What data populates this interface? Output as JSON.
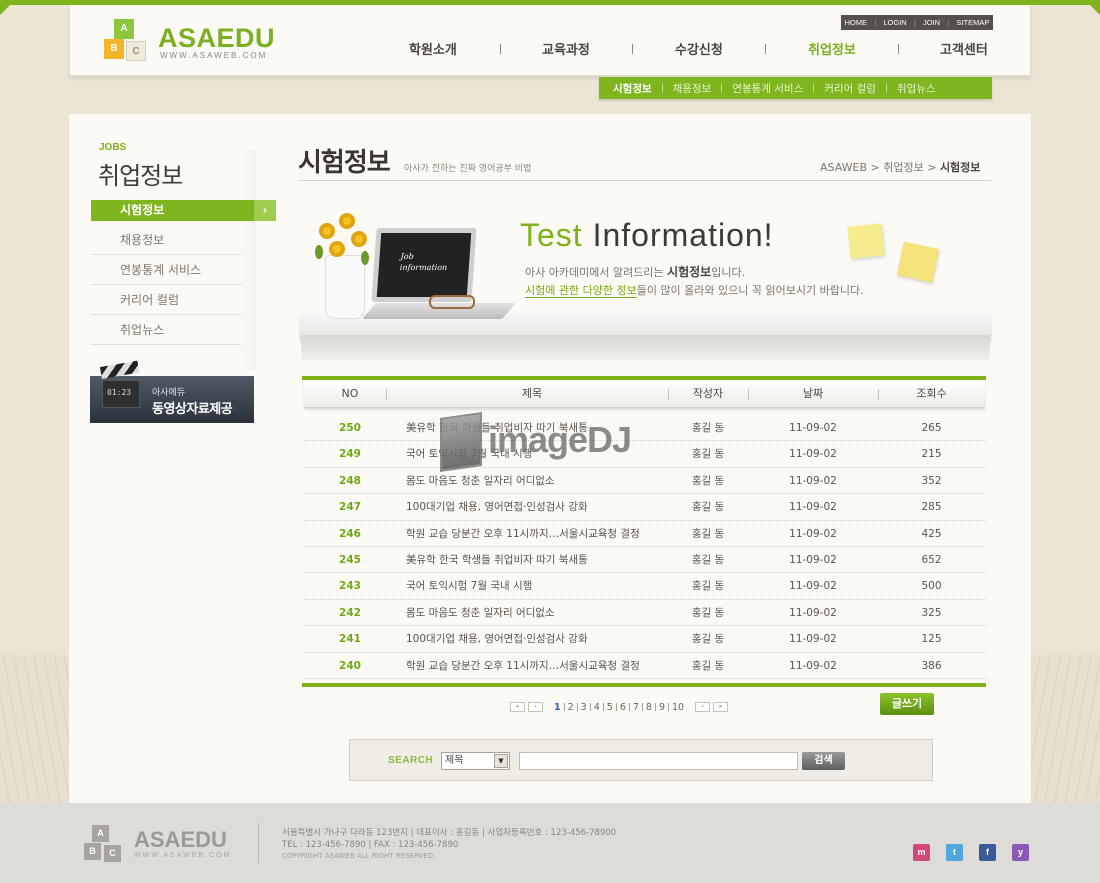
{
  "brand": {
    "name_green": "ASA",
    "name_gray": "EDU",
    "domain": "WWW.ASAWEB.COM",
    "blocks": [
      "A",
      "B",
      "C"
    ]
  },
  "util_links": [
    "HOME",
    "LOGIN",
    "JOIN",
    "SITEMAP"
  ],
  "gnb": [
    {
      "label": "학원소개",
      "active": false
    },
    {
      "label": "교육과정",
      "active": false
    },
    {
      "label": "수강신청",
      "active": false
    },
    {
      "label": "취업정보",
      "active": true
    },
    {
      "label": "고객센터",
      "active": false
    }
  ],
  "subnav": [
    {
      "label": "시험정보",
      "active": true
    },
    {
      "label": "채용정보",
      "active": false
    },
    {
      "label": "연봉통계 서비스",
      "active": false
    },
    {
      "label": "커리어 컬럼",
      "active": false
    },
    {
      "label": "취업뉴스",
      "active": false
    }
  ],
  "lnb": {
    "heading_en": "JOBS",
    "heading": "취업정보",
    "items": [
      {
        "label": "시험정보",
        "active": true
      },
      {
        "label": "채용정보",
        "active": false
      },
      {
        "label": "연봉통계 서비스",
        "active": false
      },
      {
        "label": "커리어 컬럼",
        "active": false
      },
      {
        "label": "취업뉴스",
        "active": false
      }
    ],
    "arrow": "›"
  },
  "video_banner": {
    "small": "아사에듀",
    "big": "동영상자료제공",
    "time": "01:23"
  },
  "page": {
    "title": "시험정보",
    "desc": "아사가 전하는 진짜 영어공부 비법",
    "breadcrumb": [
      "ASAWEB",
      "취업정보",
      "시험정보"
    ],
    "breadcrumb_sep": ">"
  },
  "banner": {
    "title_green": "Test",
    "title_rest": " Information!",
    "line1_pre": "아사 아카데미에서 알려드리는 ",
    "line1_bold": "시험정보",
    "line1_post": "입니다.",
    "line2_hl": "시험에 관한 다양한 정보",
    "line2_post": "들이 많이 올라와 있으니 꼭 읽어보시기 바랍니다.",
    "laptop_text_1": "Job",
    "laptop_text_2": "information"
  },
  "table": {
    "headers": [
      "NO",
      "제목",
      "작성자",
      "날짜",
      "조회수"
    ],
    "rows": [
      {
        "no": "250",
        "title": "美유학 한국 학생들 취업비자 따기 북새통",
        "writer": "홍길 동",
        "date": "11-09-02",
        "views": "265"
      },
      {
        "no": "249",
        "title": "국어 토익시험 7월 국내 시행",
        "writer": "홍길 동",
        "date": "11-09-02",
        "views": "215"
      },
      {
        "no": "248",
        "title": "몸도 마음도 청춘 일자리 어디없소",
        "writer": "홍길 동",
        "date": "11-09-02",
        "views": "352"
      },
      {
        "no": "247",
        "title": "100대기업 채용, 영어면접·인성검사 강화",
        "writer": "홍길 동",
        "date": "11-09-02",
        "views": "285"
      },
      {
        "no": "246",
        "title": "학원 교습 당분간 오후 11시까지…서울시교육청 결정",
        "writer": "홍길 동",
        "date": "11-09-02",
        "views": "425"
      },
      {
        "no": "245",
        "title": "美유학 한국 학생들 취업비자 따기 북새통",
        "writer": "홍길 동",
        "date": "11-09-02",
        "views": "652"
      },
      {
        "no": "243",
        "title": "국어 토익시험 7월 국내 시행",
        "writer": "홍길 동",
        "date": "11-09-02",
        "views": "500"
      },
      {
        "no": "242",
        "title": "몸도 마음도 청춘 일자리 어디없소",
        "writer": "홍길 동",
        "date": "11-09-02",
        "views": "325"
      },
      {
        "no": "241",
        "title": "100대기업 채용, 영어면접·인성검사 강화",
        "writer": "홍길 동",
        "date": "11-09-02",
        "views": "125"
      },
      {
        "no": "240",
        "title": "학원 교습 당분간 오후 11시까지…서울시교육청 결정",
        "writer": "홍길 동",
        "date": "11-09-02",
        "views": "386"
      }
    ]
  },
  "watermark": "imageDJ",
  "paging": {
    "first": "«",
    "prev": "‹",
    "next": "›",
    "last": "»",
    "pages": [
      "1",
      "2",
      "3",
      "4",
      "5",
      "6",
      "7",
      "8",
      "9",
      "10"
    ],
    "current": "1"
  },
  "write_button": "글쓰기",
  "search": {
    "label": "SEARCH",
    "select_value": "제목",
    "dropdown_glyph": "▼",
    "input_value": "",
    "button": "검색"
  },
  "footer": {
    "logo": "ASAEDU",
    "logo_sub": "WWW.ASAWEB.COM",
    "address": "서울특별시 가나구 다라동 123번지  |  대표이사 : 홍길동  |  사업자등록번호 : 123-456-78900",
    "contact": "TEL : 123-456-7890  |  FAX : 123-456-7890",
    "copyright": "COPYRIGHT ASAWEB ALL RIGHT RESERVED.",
    "sns": [
      {
        "name": "me2day",
        "glyph": "m",
        "color": "#d2487a"
      },
      {
        "name": "twitter",
        "glyph": "t",
        "color": "#4fa7dd"
      },
      {
        "name": "facebook",
        "glyph": "f",
        "color": "#3b5998"
      },
      {
        "name": "yozm",
        "glyph": "y",
        "color": "#8a5bb5"
      }
    ]
  },
  "colors": {
    "accent": "#7fb21b",
    "accent_light": "#a0cd4e",
    "text": "#4a463f",
    "bg": "#ece5d6"
  }
}
